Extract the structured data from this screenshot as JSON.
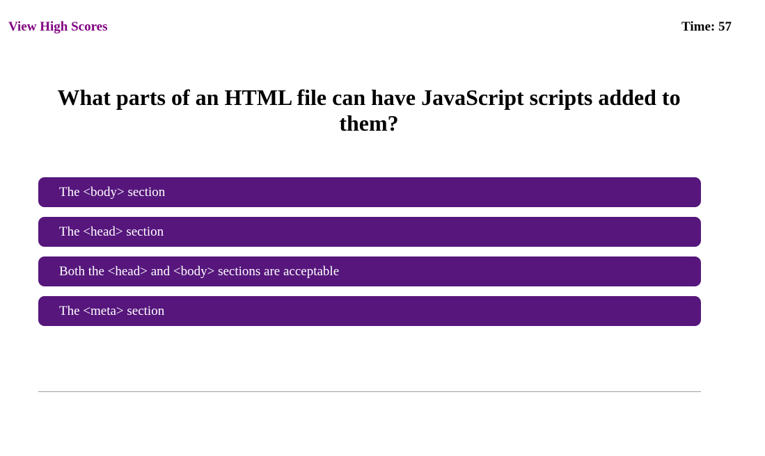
{
  "header": {
    "high_scores_label": "View High Scores",
    "timer_label": "Time:",
    "timer_value": "57"
  },
  "quiz": {
    "question": "What parts of an HTML file can have JavaScript scripts added to them?",
    "answers": [
      {
        "label": "The <body> section"
      },
      {
        "label": "The <head> section"
      },
      {
        "label": "Both the <head> and <body> sections are acceptable"
      },
      {
        "label": "The <meta> section"
      }
    ]
  },
  "colors": {
    "link": "#800080",
    "answer_bg": "#56167c",
    "answer_text": "#ffffff",
    "divider": "#9e9e9e"
  }
}
